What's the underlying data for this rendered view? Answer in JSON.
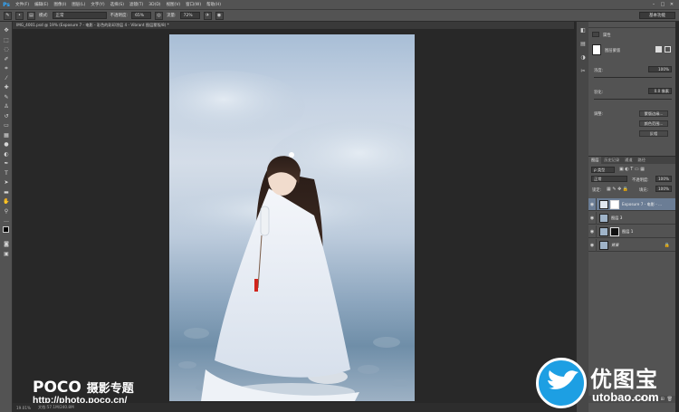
{
  "app": {
    "logo": "Ps"
  },
  "menu": [
    "文件(F)",
    "编辑(E)",
    "图像(I)",
    "图层(L)",
    "文字(Y)",
    "选择(S)",
    "滤镜(T)",
    "3D(D)",
    "视图(V)",
    "窗口(W)",
    "帮助(H)"
  ],
  "window_controls": [
    "–",
    "□",
    "✕"
  ],
  "options": {
    "mode_label": "模式:",
    "mode_value": "正常",
    "opacity_label": "不透明度:",
    "opacity_value": "65%",
    "flow_label": "流量:",
    "flow_value": "72%",
    "workspace": "基本功能"
  },
  "document": {
    "tab_title": "IMG_4001.psd @ 19% (Exposure 7 - 电影 - 彩色的彩印涂层 4 - Vibrant 图层蒙版/8) *",
    "zoom": "19.01%",
    "doc_size": "文档:57.1M/240.8M"
  },
  "properties": {
    "title": "属性",
    "subtitle": "图层蒙版",
    "density_label": "浓度:",
    "density_value": "100%",
    "feather_label": "羽化:",
    "feather_value": "0.0 像素",
    "refine_label": "调整:",
    "btn_mask_edge": "蒙版边缘...",
    "btn_color_range": "颜色范围...",
    "btn_invert": "反相"
  },
  "layers_panel": {
    "tabs": [
      "图层",
      "历史记录",
      "通道",
      "路径"
    ],
    "kind_label": "ρ 类型",
    "blend_mode": "正常",
    "opacity_label": "不透明度:",
    "opacity_value": "100%",
    "lock_label": "锁定:",
    "fill_label": "填充:",
    "fill_value": "100%",
    "layers": [
      {
        "name": "Exposure 7 - 电影 - ...",
        "selected": true,
        "has_mask": true
      },
      {
        "name": "图层 3",
        "selected": false,
        "has_mask": false
      },
      {
        "name": "图层 1",
        "selected": false,
        "has_mask": true
      },
      {
        "name": "背景",
        "selected": false,
        "has_mask": false
      }
    ]
  },
  "watermark": {
    "brand": "POCO",
    "brand_cn": "摄影专题",
    "url": "http://photo.poco.cn/"
  },
  "site_logo": {
    "cn": "优图宝",
    "en": "utobao.com"
  },
  "colors": {
    "ui_dark": "#535353",
    "canvas_bg": "#282828",
    "selection": "#6b7d95",
    "accent": "#1d9fe3"
  }
}
